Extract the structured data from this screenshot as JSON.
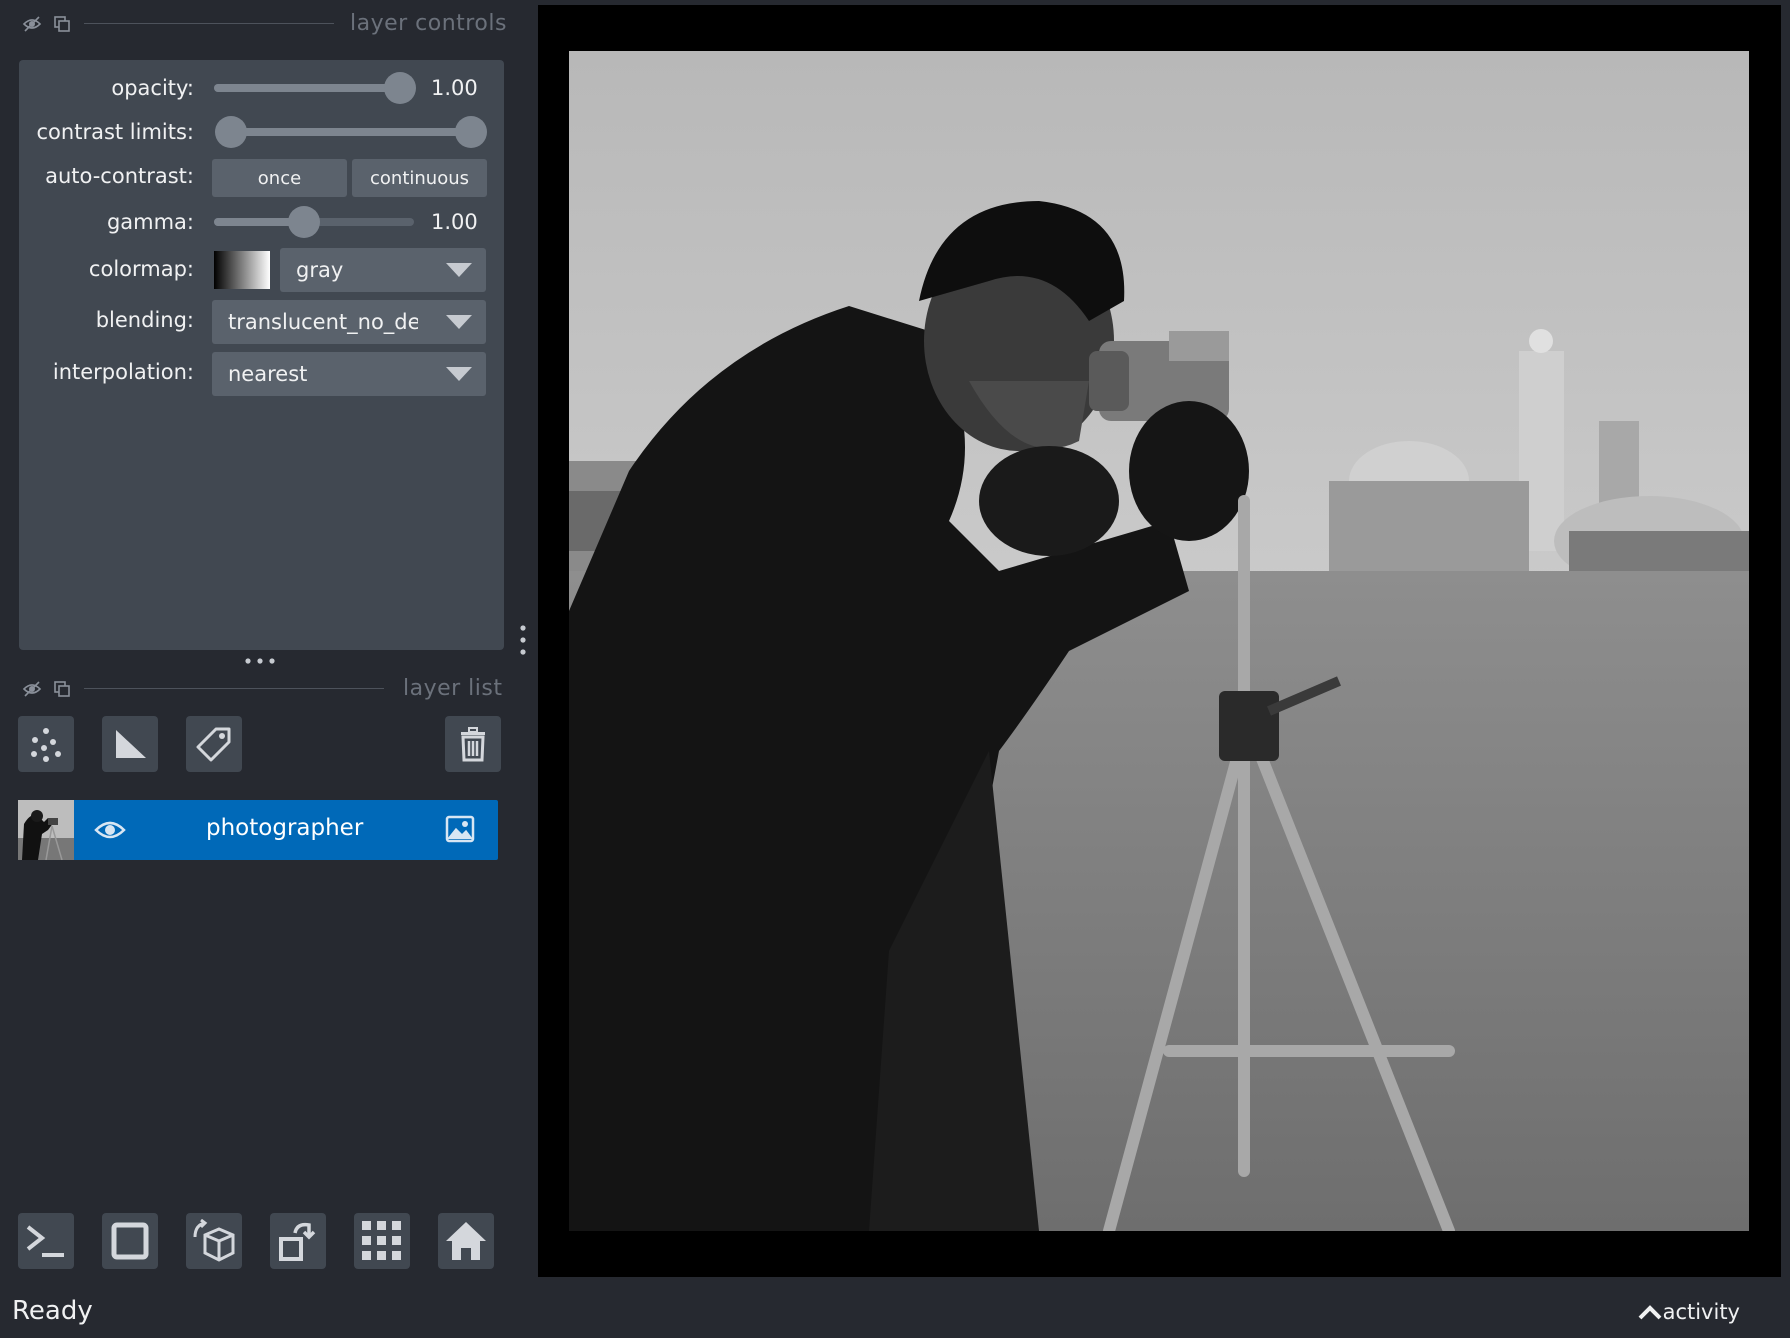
{
  "layer_controls": {
    "title": "layer controls",
    "opacity": {
      "label": "opacity:",
      "value": "1.00",
      "level": 1.0
    },
    "contrast_limits": {
      "label": "contrast limits:",
      "low": 0.0,
      "high": 1.0
    },
    "auto_contrast": {
      "label": "auto-contrast:",
      "once_label": "once",
      "continuous_label": "continuous"
    },
    "gamma": {
      "label": "gamma:",
      "value": "1.00",
      "level": 0.45
    },
    "colormap": {
      "label": "colormap:",
      "selected": "gray"
    },
    "blending": {
      "label": "blending:",
      "selected": "translucent_no_depth"
    },
    "interpolation": {
      "label": "interpolation:",
      "selected": "nearest"
    }
  },
  "layer_list": {
    "title": "layer list",
    "tools": [
      "points-icon",
      "shapes-icon",
      "labels-icon",
      "delete-icon"
    ],
    "layers": [
      {
        "name": "photographer",
        "visible": true,
        "type": "image-icon"
      }
    ]
  },
  "bottom_toolbar": [
    "console-icon",
    "ndisplay-square-icon",
    "3d-cube-icon",
    "roll-icon",
    "grid-icon",
    "home-icon"
  ],
  "status": {
    "text": "Ready",
    "activity_label": "activity"
  },
  "colors": {
    "background": "#262930",
    "panel": "#414851",
    "control": "#5a626c",
    "accent": "#0069b8",
    "text": "#f0f1f2"
  }
}
